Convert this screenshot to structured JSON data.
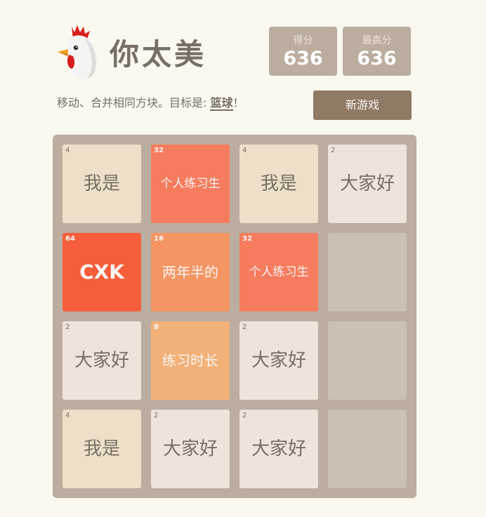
{
  "header": {
    "title": "你太美",
    "logo_icon": "rooster-icon",
    "score_label": "得分",
    "score_value": "636",
    "best_label": "最高分",
    "best_value": "636"
  },
  "intro": {
    "text_before": "移动、合并相同方块。目标是: ",
    "goal": "篮球",
    "text_after": "！"
  },
  "new_game_label": "新游戏",
  "board": {
    "rows": [
      [
        {
          "value": "4",
          "label": "我是"
        },
        {
          "value": "32",
          "label": "个人练习生"
        },
        {
          "value": "4",
          "label": "我是"
        },
        {
          "value": "2",
          "label": "大家好"
        }
      ],
      [
        {
          "value": "64",
          "label": "CXK"
        },
        {
          "value": "16",
          "label": "两年半的"
        },
        {
          "value": "32",
          "label": "个人练习生"
        },
        null
      ],
      [
        {
          "value": "2",
          "label": "大家好"
        },
        {
          "value": "8",
          "label": "练习时长"
        },
        {
          "value": "2",
          "label": "大家好"
        },
        null
      ],
      [
        {
          "value": "4",
          "label": "我是"
        },
        {
          "value": "2",
          "label": "大家好"
        },
        {
          "value": "2",
          "label": "大家好"
        },
        null
      ]
    ]
  },
  "colors": {
    "background": "#faf8ef",
    "board": "#bbada0",
    "text_dark": "#776e65",
    "tile_2": "#eee4da",
    "tile_4": "#ede0c8",
    "tile_8": "#f2b179",
    "tile_16": "#f59563",
    "tile_32": "#f67c5f",
    "tile_64": "#f65e3b",
    "button": "#8f7a66"
  }
}
